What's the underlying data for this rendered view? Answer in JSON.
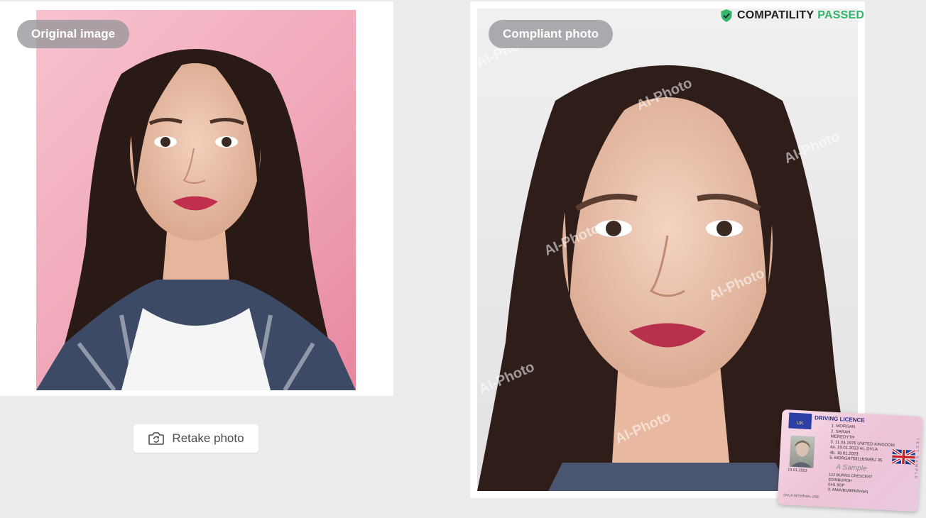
{
  "left_panel": {
    "label": "Original image",
    "retake_label": "Retake photo"
  },
  "right_panel": {
    "label": "Compliant photo",
    "watermark": "AI-Photo",
    "compat_word1": "COMPATILITY",
    "compat_word2": "PASSED"
  },
  "licence": {
    "eu": "UK",
    "title": "DRIVING LICENCE",
    "line1": "1.  MORGAN",
    "line2": "2.  SARAH",
    "line2b": "MEREDYTH",
    "line3": "3.  11.03.1976  UNITED KINGDOM",
    "line4": "4a. 19.01.2013   4c. DVLA",
    "line5": "4b. 18.01.2023",
    "line6": "5.  MORGA753116SM9IJ  35",
    "dob": "19.01.2023",
    "addr1": "122 BURNS CRESCENT",
    "addr2": "EDINBURGH",
    "addr3": "EH1 9GP",
    "cats": "9.  AM/A/B1/B/f/k/l/n/p/q",
    "footer": "DVLA  INTERNAL USE",
    "side": "TEST SAMPLE",
    "signature": "A Sample"
  },
  "colors": {
    "background": "#ececec",
    "pass_green": "#33b56b",
    "pill_gray": "#96969b"
  }
}
